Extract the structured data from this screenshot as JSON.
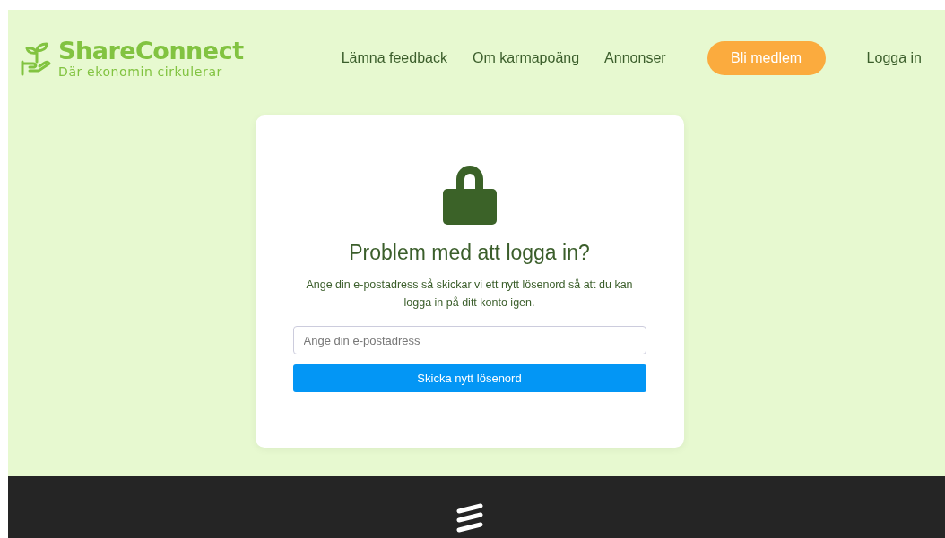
{
  "header": {
    "brand": "ShareConnect",
    "tagline": "Där ekonomin cirkulerar",
    "nav": [
      {
        "label": "Lämna feedback",
        "kind": "link"
      },
      {
        "label": "Om karmapoäng",
        "kind": "link"
      },
      {
        "label": "Annonser",
        "kind": "link"
      },
      {
        "label": "Bli medlem",
        "kind": "button"
      },
      {
        "label": "Logga in",
        "kind": "link"
      }
    ]
  },
  "card": {
    "title": "Problem med att logga in?",
    "text": "Ange din e-postadress så skickar vi ett nytt lösenord så att du kan logga in på ditt konto igen.",
    "email": {
      "placeholder": "Ange din e-postadress"
    },
    "submit": "Skicka nytt lösenord"
  }
}
